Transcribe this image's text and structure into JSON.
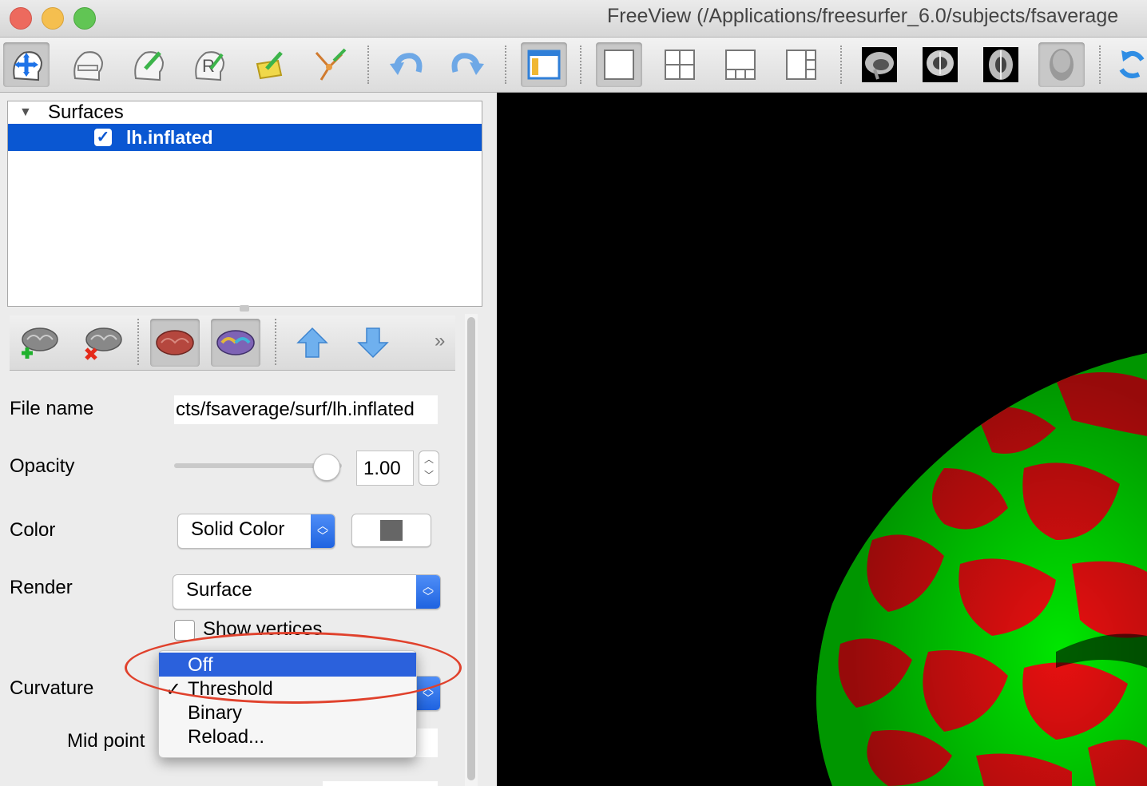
{
  "window": {
    "title": "FreeView (/Applications/freesurfer_6.0/subjects/fsaverage",
    "buttons": [
      "close",
      "minimize",
      "zoom"
    ],
    "colors": {
      "close": "#ed6a5e",
      "minimize": "#f5bf4f",
      "zoom": "#61c554"
    }
  },
  "toolbar": {
    "items": [
      "navigate-tool",
      "voxel-edit-tool",
      "recon-edit-tool",
      "roi-edit-tool",
      "point-set-edit-tool",
      "path-tool",
      "undo",
      "redo",
      "toggle-panel",
      "layout-1x1",
      "layout-2x2",
      "layout-1-3",
      "layout-1-3-horizontal",
      "view-sagittal",
      "view-coronal",
      "view-axial",
      "view-3d",
      "reset-view"
    ]
  },
  "layers": {
    "group_label": "Surfaces",
    "items": [
      {
        "name": "lh.inflated",
        "checked": true,
        "selected": true
      }
    ]
  },
  "layer_toolbar": {
    "items": [
      "add-surface",
      "remove-surface",
      "surface-color",
      "surface-overlay",
      "move-up",
      "move-down"
    ],
    "more": "»"
  },
  "properties": {
    "file_name_label": "File name",
    "file_name_value": "cts/fsaverage/surf/lh.inflated",
    "opacity_label": "Opacity",
    "opacity_value": "1.00",
    "opacity_fraction": 1.0,
    "color_label": "Color",
    "color_mode": "Solid Color",
    "color_swatch": "#666666",
    "render_label": "Render",
    "render_value": "Surface",
    "show_vertices_label": "Show vertices",
    "show_vertices_checked": false,
    "curvature_label": "Curvature",
    "mid_point_label": "Mid point"
  },
  "curvature_menu": {
    "items": [
      {
        "label": "Off",
        "highlighted": true,
        "checked": false
      },
      {
        "label": "Threshold",
        "highlighted": false,
        "checked": true
      },
      {
        "label": "Binary",
        "highlighted": false,
        "checked": false
      },
      {
        "label": "Reload...",
        "highlighted": false,
        "checked": false
      }
    ],
    "check_mark": "✓"
  },
  "viewport": {
    "background": "#000000",
    "surface_colors": [
      "#ff0000",
      "#00ff00"
    ]
  },
  "annotation": {
    "color": "#e0412c"
  }
}
